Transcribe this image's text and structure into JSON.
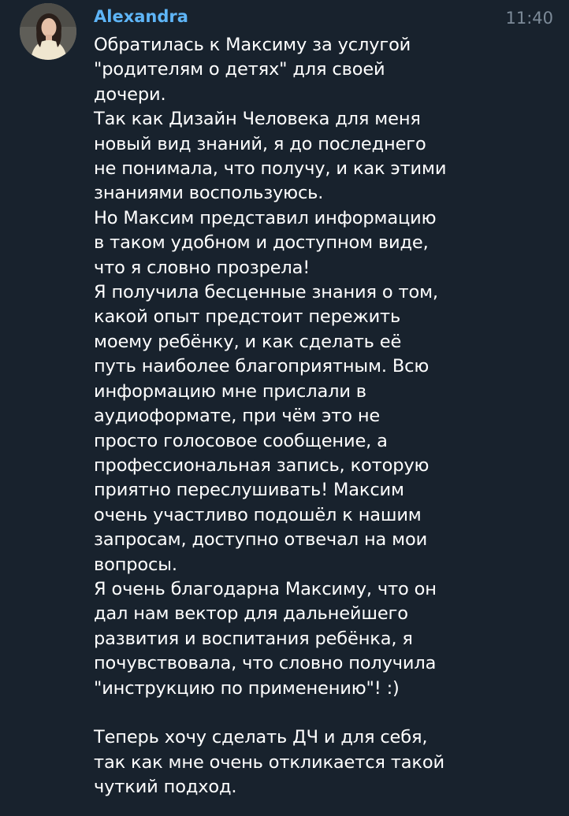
{
  "message": {
    "sender": "Alexandra",
    "time": "11:40",
    "avatar_icon": "user-avatar-photo",
    "colors": {
      "background": "#18222d",
      "sender": "#5eb5f7",
      "time": "#7d8b99",
      "text": "#ffffff"
    },
    "text": "Обратилась к Максиму за услугой\n\"родителям о детях\" для своей\nдочери.\nТак как Дизайн Человека для меня\nновый вид знаний, я до последнего\nне понимала, что получу, и как этими\nзнаниями воспользуюсь.\nНо Максим представил информацию\nв таком удобном и доступном виде,\nчто я словно прозрела!\nЯ получила бесценные знания о том,\nкакой опыт предстоит пережить\nмоему ребёнку, и как сделать её\nпуть наиболее благоприятным. Всю\nинформацию мне прислали в\nаудиоформате, при чём это не\nпросто голосовое сообщение, а\nпрофессиональная запись, которую\nприятно переслушивать! Максим\nочень участливо подошёл к нашим\nзапросам, доступно отвечал на мои\nвопросы.\nЯ очень благодарна Максиму, что он\nдал нам вектор для дальнейшего\nразвития и воспитания ребёнка, я\nпочувствовала, что словно получила\n\"инструкцию по применению\"! :)\n\nТеперь хочу сделать ДЧ и для себя,\nтак как мне очень откликается такой\nчуткий подход."
  }
}
